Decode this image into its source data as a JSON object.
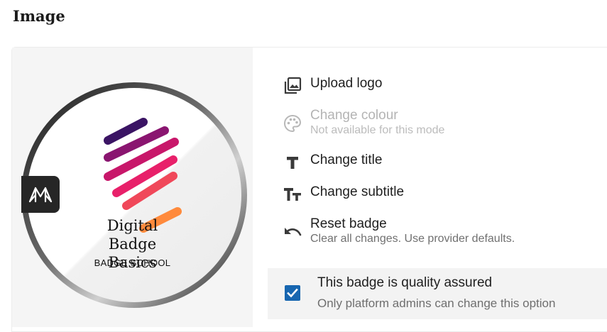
{
  "section": {
    "title": "Image"
  },
  "badge": {
    "title": "Digital Badge Basics",
    "subtitle": "BADGE SCHOOL",
    "side_tab_icon": "provider-logo-icon",
    "logo_colors": [
      "#3b1464",
      "#c8176a",
      "#e8206a",
      "#ff8a3c"
    ]
  },
  "options": [
    {
      "icon": "image-icon",
      "label": "Upload logo",
      "enabled": true
    },
    {
      "icon": "palette-icon",
      "label": "Change colour",
      "sub": "Not available for this mode",
      "enabled": false
    },
    {
      "icon": "title-icon",
      "label": "Change title",
      "enabled": true
    },
    {
      "icon": "text-size-icon",
      "label": "Change subtitle",
      "enabled": true
    },
    {
      "icon": "undo-icon",
      "label": "Reset badge",
      "sub": "Clear all changes. Use provider defaults.",
      "enabled": true
    }
  ],
  "quality": {
    "checked": true,
    "label": "This badge is quality assured",
    "sub": "Only platform admins can change this option",
    "accent": "#1766b0"
  }
}
